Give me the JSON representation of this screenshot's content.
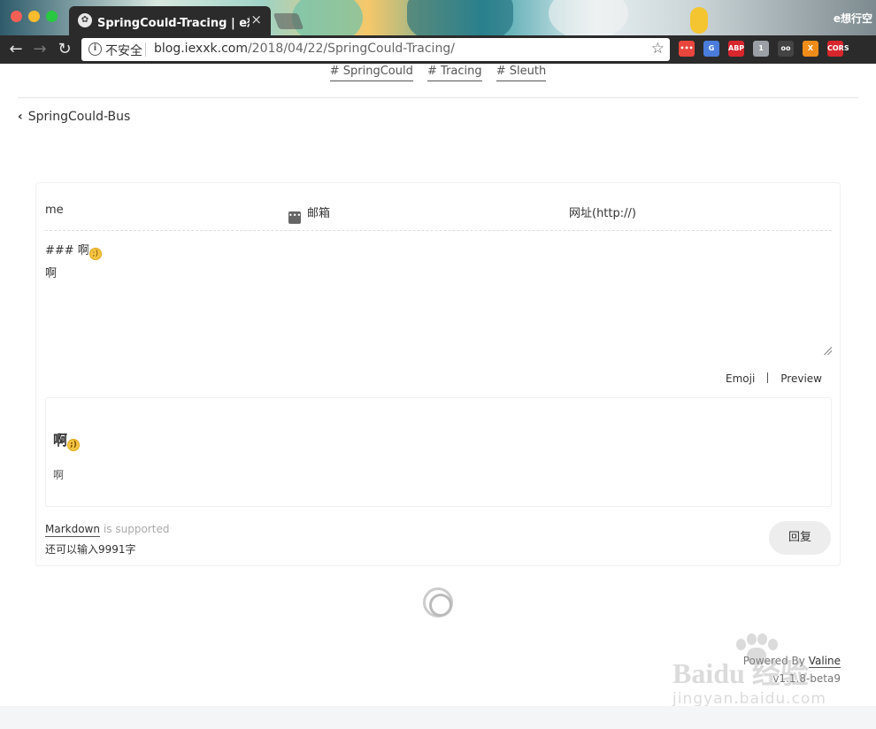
{
  "browser": {
    "tab_title": "SpringCould-Tracing | e想行空",
    "tab_close": "×",
    "profile_name": "e想行空",
    "security_label": "不安全",
    "url_domain": "blog.iexxk.com",
    "url_path": "/2018/04/22/SpringCould-Tracing/",
    "extensions": [
      {
        "name": "ext-red-icon",
        "label": "•••",
        "color": "#e8453c"
      },
      {
        "name": "google-translate-icon",
        "label": "G",
        "color": "#4a7cdc"
      },
      {
        "name": "adblock-plus-icon",
        "label": "ABP",
        "color": "#d8262d"
      },
      {
        "name": "ext-badge-icon",
        "label": "1",
        "color": "#9aa0a6"
      },
      {
        "name": "ext-glasses-icon",
        "label": "oo",
        "color": "#444444"
      },
      {
        "name": "ext-orange-icon",
        "label": "X",
        "color": "#f08c1a"
      },
      {
        "name": "cors-icon",
        "label": "CORS",
        "color": "#d8262d"
      }
    ]
  },
  "post": {
    "tags": [
      "# SpringCould",
      "# Tracing",
      "# Sleuth"
    ],
    "prev_post": "SpringCould-Bus"
  },
  "comment_form": {
    "nick_value": "me",
    "mail_placeholder": "邮箱",
    "link_placeholder": "网址(http://)",
    "editor_line1": "### 啊",
    "editor_line2": "啊",
    "emoji_button": "Emoji",
    "preview_button": "Preview",
    "preview_heading": "啊",
    "preview_body": "啊",
    "markdown_link": "Markdown",
    "markdown_supported": "is supported",
    "char_count": "还可以输入9991字",
    "submit_label": "回复"
  },
  "footer": {
    "powered_text": "Powered By",
    "powered_link": "Valine",
    "version": "v1.1.8-beta9"
  },
  "watermark": {
    "logo": "Baidu 经验",
    "sub": "jingyan.baidu.com"
  }
}
